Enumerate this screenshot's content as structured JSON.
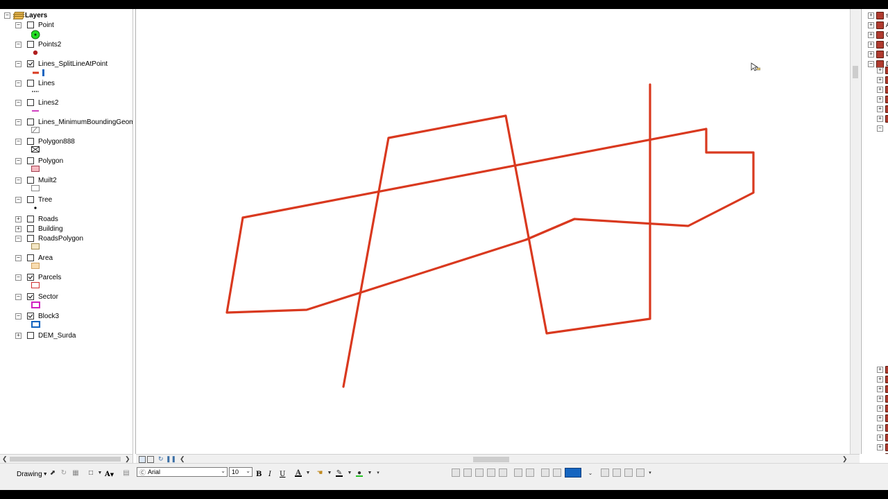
{
  "toc": {
    "root_label": "Layers",
    "layers": [
      {
        "name": "Point",
        "checked": false,
        "expand": "-",
        "symbol": "green-circle-point-icon"
      },
      {
        "name": "Points2",
        "checked": false,
        "expand": "-",
        "symbol": "red-dot-point-icon"
      },
      {
        "name": "Lines_SplitLineAtPoint",
        "checked": true,
        "expand": "-",
        "symbol": "red-line-icon"
      },
      {
        "name": "Lines",
        "checked": false,
        "expand": "-",
        "symbol": "gray-line-icon"
      },
      {
        "name": "Lines2",
        "checked": false,
        "expand": "-",
        "symbol": "magenta-line-icon"
      },
      {
        "name": "Lines_MinimumBoundingGeomet",
        "checked": false,
        "expand": "-",
        "symbol": "hatched-polygon-icon"
      },
      {
        "name": "Polygon888",
        "checked": false,
        "expand": "-",
        "symbol": "cross-hatch-polygon-icon"
      },
      {
        "name": "Polygon",
        "checked": false,
        "expand": "-",
        "symbol": "pink-polygon-icon"
      },
      {
        "name": "Muilt2",
        "checked": false,
        "expand": "-",
        "symbol": "white-polygon-icon"
      },
      {
        "name": "Tree",
        "checked": false,
        "expand": "-",
        "symbol": "black-dot-point-icon"
      },
      {
        "name": "Roads",
        "checked": false,
        "expand": "+",
        "symbol": ""
      },
      {
        "name": "Building",
        "checked": false,
        "expand": "+",
        "symbol": ""
      },
      {
        "name": "RoadsPolygon",
        "checked": false,
        "expand": "-",
        "symbol": "tan-polygon-icon"
      },
      {
        "name": "Area",
        "checked": false,
        "expand": "-",
        "symbol": "orange-hatched-polygon-icon"
      },
      {
        "name": "Parcels",
        "checked": true,
        "expand": "-",
        "symbol": "red-outline-polygon-icon"
      },
      {
        "name": "Sector",
        "checked": true,
        "expand": "-",
        "symbol": "magenta-outline-polygon-icon"
      },
      {
        "name": "Block3",
        "checked": true,
        "expand": "-",
        "symbol": "blue-outline-polygon-icon"
      },
      {
        "name": "DEM_Surda",
        "checked": false,
        "expand": "+",
        "symbol": ""
      }
    ]
  },
  "map": {
    "line_color": "#d9391f"
  },
  "catalog": {
    "items": [
      {
        "label": "s",
        "expand": "+"
      },
      {
        "label": "A",
        "expand": "+"
      },
      {
        "label": "C",
        "expand": "+"
      },
      {
        "label": "C",
        "expand": "+"
      },
      {
        "label": "D",
        "expand": "+"
      },
      {
        "label": "D",
        "expand": "-"
      }
    ]
  },
  "toolbar": {
    "drawing_label": "Drawing",
    "font_name": "Arial",
    "font_size": "10",
    "bold_label": "B",
    "italic_label": "I",
    "underline_label": "U",
    "font_color_label": "A",
    "text_tool_label": "A"
  },
  "colors": {
    "accent_blue": "#1565c0",
    "line_red": "#d9391f"
  }
}
